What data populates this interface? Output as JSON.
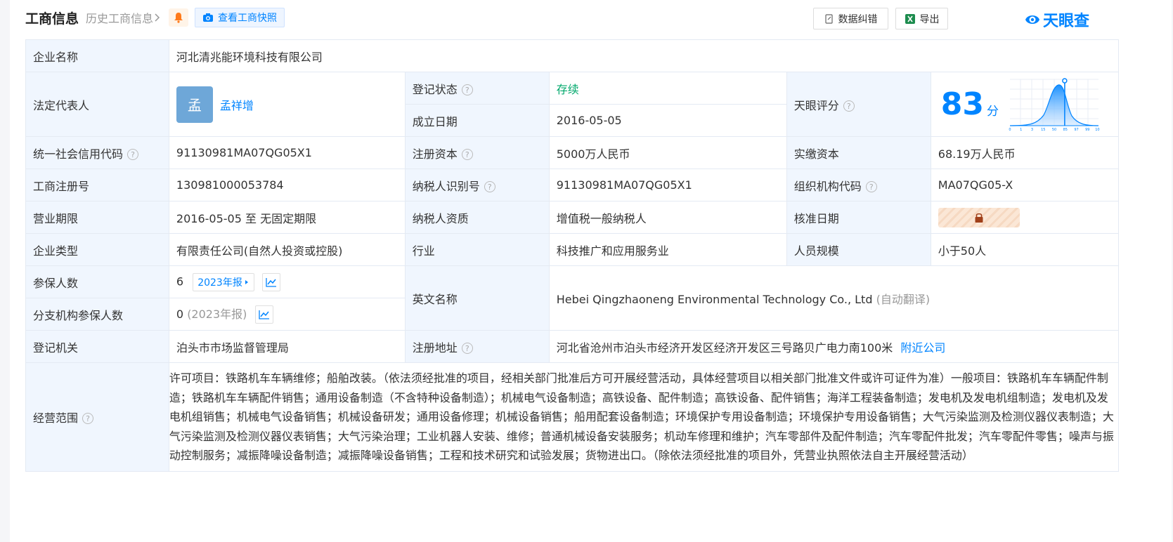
{
  "header": {
    "title": "工商信息",
    "history_link": "历史工商信息",
    "snapshot_button": "查看工商快照",
    "correction_button": "数据纠错",
    "export_button": "导出",
    "logo_text": "天眼查"
  },
  "rows": {
    "company_name_label": "企业名称",
    "company_name": "河北清兆能环境科技有限公司",
    "legal_rep_label": "法定代表人",
    "legal_rep_avatar": "孟",
    "legal_rep_name": "孟祥增",
    "reg_status_label": "登记状态",
    "reg_status": "存续",
    "established_label": "成立日期",
    "established": "2016-05-05",
    "score_label": "天眼评分",
    "score_value": "83",
    "score_unit": "分",
    "credit_code_label": "统一社会信用代码",
    "credit_code": "91130981MA07QG05X1",
    "reg_capital_label": "注册资本",
    "reg_capital": "5000万人民币",
    "paid_capital_label": "实缴资本",
    "paid_capital": "68.19万人民币",
    "biz_reg_no_label": "工商注册号",
    "biz_reg_no": "130981000053784",
    "taxpayer_id_label": "纳税人识别号",
    "taxpayer_id": "91130981MA07QG05X1",
    "org_code_label": "组织机构代码",
    "org_code": "MA07QG05-X",
    "term_label": "营业期限",
    "term": "2016-05-05 至 无固定期限",
    "taxpayer_qual_label": "纳税人资质",
    "taxpayer_qual": "增值税一般纳税人",
    "approval_date_label": "核准日期",
    "company_type_label": "企业类型",
    "company_type": "有限责任公司(自然人投资或控股)",
    "industry_label": "行业",
    "industry": "科技推广和应用服务业",
    "staff_size_label": "人员规模",
    "staff_size": "小于50人",
    "insured_label": "参保人数",
    "insured": "6",
    "insured_report_tag": "2023年报",
    "english_name_label": "英文名称",
    "english_name": "Hebei Qingzhaoneng Environmental Technology Co., Ltd",
    "english_name_note": "(自动翻译)",
    "branch_insured_label": "分支机构参保人数",
    "branch_insured": "0",
    "branch_insured_note": "(2023年报)",
    "authority_label": "登记机关",
    "authority": "泊头市市场监督管理局",
    "address_label": "注册地址",
    "address": "河北省沧州市泊头市经济开发区经济开发区三号路贝广电力南100米",
    "nearby_link": "附近公司",
    "scope_label": "经营范围",
    "scope": "许可项目：铁路机车车辆维修；船舶改装。（依法须经批准的项目，经相关部门批准后方可开展经营活动，具体经营项目以相关部门批准文件或许可证件为准）一般项目：铁路机车车辆配件制造；铁路机车车辆配件销售；通用设备制造（不含特种设备制造）；机械电气设备制造；高铁设备、配件制造；高铁设备、配件销售；海洋工程装备制造；发电机及发电机组制造；发电机及发电机组销售；机械电气设备销售；机械设备研发；通用设备修理；机械设备销售；船用配套设备制造；环境保护专用设备制造；环境保护专用设备销售；大气污染监测及检测仪器仪表制造；大气污染监测及检测仪器仪表销售；大气污染治理；工业机器人安装、维修；普通机械设备安装服务；机动车修理和维护；汽车零部件及配件制造；汽车零配件批发；汽车零配件零售；噪声与振动控制服务；减振降噪设备制造；减振降噪设备销售；工程和技术研究和试验发展；货物进出口。（除依法须经批准的项目外，凭营业执照依法自主开展经营活动）"
  },
  "score_chart": {
    "x_ticks": [
      "0",
      "1",
      "3",
      "15",
      "50",
      "85",
      "97",
      "99",
      "100"
    ],
    "marker_value": 83
  },
  "colors": {
    "accent": "#0084ff",
    "label_bg": "#f0f6fe",
    "status_green": "#00a86b"
  }
}
